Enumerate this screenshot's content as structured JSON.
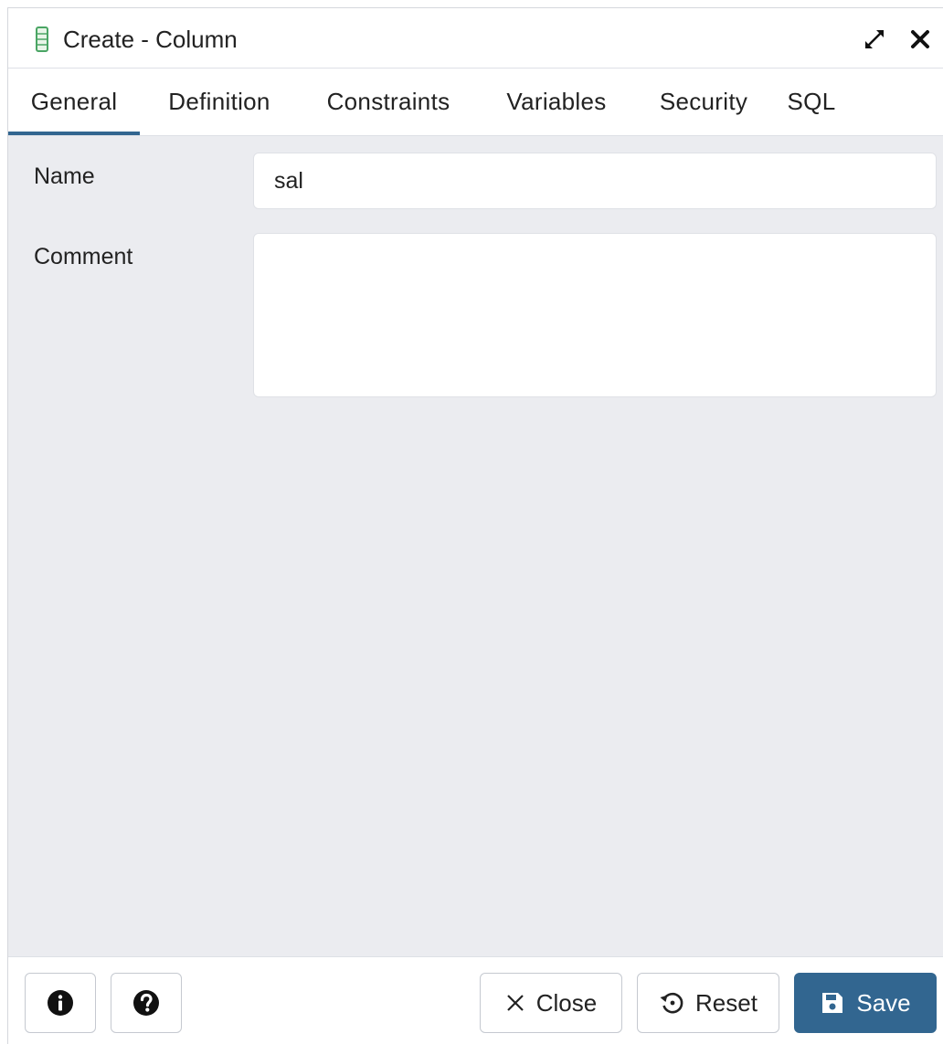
{
  "dialog": {
    "title": "Create - Column"
  },
  "tabs": [
    {
      "label": "General",
      "active": true
    },
    {
      "label": "Definition",
      "active": false
    },
    {
      "label": "Constraints",
      "active": false
    },
    {
      "label": "Variables",
      "active": false
    },
    {
      "label": "Security",
      "active": false
    },
    {
      "label": "SQL",
      "active": false
    }
  ],
  "form": {
    "name_label": "Name",
    "name_value": "sal",
    "comment_label": "Comment",
    "comment_value": ""
  },
  "footer": {
    "info_icon": "info-circle-icon",
    "help_icon": "question-circle-icon",
    "close_label": "Close",
    "reset_label": "Reset",
    "save_label": "Save"
  },
  "colors": {
    "accent": "#326690",
    "background": "#ebecf0",
    "title_icon": "#5cb85c"
  }
}
